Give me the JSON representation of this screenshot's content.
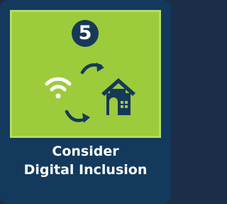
{
  "card": {
    "step_number": "5",
    "title_line1": "Consider",
    "title_line2": "Digital Inclusion",
    "icons": [
      "wifi-icon",
      "cycle-arrow-icon",
      "house-icon"
    ],
    "colors": {
      "background": "#133a5c",
      "panel": "#9ccb3b",
      "badge": "#16395a",
      "text": "#ffffff"
    }
  }
}
